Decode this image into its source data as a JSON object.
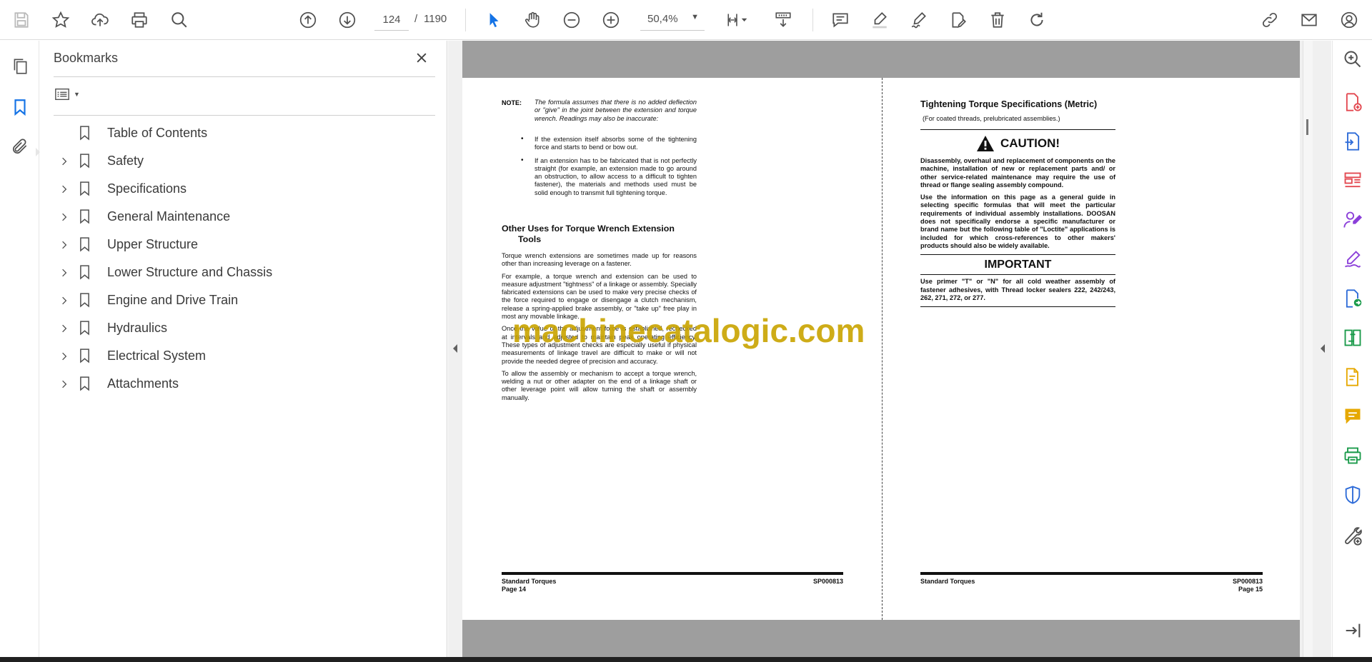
{
  "toolbar": {
    "current_page": "124",
    "page_separator": "/",
    "total_pages": "1190",
    "zoom": "50,4%",
    "icons": [
      "save-icon",
      "bookmark-star-icon",
      "upload-icon",
      "print-icon",
      "zoom-find-icon",
      "prev-page-icon",
      "next-page-icon",
      "select-cursor-icon",
      "hand-icon",
      "zoom-out-icon",
      "zoom-in-icon",
      "page-fit-icon",
      "scroll-mode-icon",
      "comment-icon",
      "highlight-icon",
      "sign-icon",
      "fill-sign-icon",
      "delete-icon",
      "rotate-icon",
      "share-link-icon",
      "email-icon",
      "account-icon"
    ]
  },
  "bookmarks": {
    "title": "Bookmarks",
    "items": [
      {
        "label": "Table of Contents",
        "expandable": false
      },
      {
        "label": "Safety",
        "expandable": true
      },
      {
        "label": "Specifications",
        "expandable": true
      },
      {
        "label": "General Maintenance",
        "expandable": true
      },
      {
        "label": "Upper Structure",
        "expandable": true
      },
      {
        "label": "Lower Structure and Chassis",
        "expandable": true
      },
      {
        "label": "Engine and Drive Train",
        "expandable": true
      },
      {
        "label": "Hydraulics",
        "expandable": true
      },
      {
        "label": "Electrical System",
        "expandable": true
      },
      {
        "label": "Attachments",
        "expandable": true
      }
    ]
  },
  "document": {
    "left_page": {
      "note_label": "NOTE:",
      "note_text": "The formula assumes that there is no added deflection or \"give\" in the joint between the extension and torque wrench. Readings may also be inaccurate:",
      "bullets": [
        "If the extension itself absorbs some of the tightening force and starts to bend or bow out.",
        "If an extension has to be fabricated that is not perfectly straight (for example, an extension made to go around an obstruction, to allow access to a difficult to tighten fastener), the materials and methods used must be solid enough to transmit full tightening torque."
      ],
      "heading_line1": "Other Uses for Torque Wrench Extension",
      "heading_line2": "Tools",
      "paragraphs": [
        "Torque wrench extensions are sometimes made up for reasons other than increasing leverage on a fastener.",
        "For example, a torque wrench and extension can be used to measure adjustment \"tightness\" of a linkage or assembly. Specially fabricated extensions can be used to make very precise checks of the force required to engage or disengage a clutch mechanism, release a spring-applied brake assembly, or \"take up\" free play in most any movable linkage.",
        "Once the value of the adjustment force is established, rechecked at intervals and adjusted to maintain peak operating efficiency. These types of adjustment checks are especially useful if physical measurements of linkage travel are difficult to make or will not provide the needed degree of precision and accuracy.",
        "To allow the assembly or mechanism to accept a torque wrench, welding a nut or other adapter on the end of a linkage shaft or other leverage point will allow turning the shaft or assembly manually."
      ],
      "footer_title": "Standard Torques",
      "footer_page": "Page 14",
      "footer_code": "SP000813"
    },
    "right_page": {
      "heading": "Tightening Torque Specifications (Metric)",
      "subheading": "(For coated threads, prelubricated assemblies.)",
      "caution_title": "CAUTION!",
      "caution_p1": "Disassembly, overhaul and replacement of components on the machine, installation of new or replacement parts and/ or other service-related maintenance may require the use of thread or flange sealing assembly compound.",
      "caution_p2": "Use the information on this page as a general guide in selecting specific formulas that will meet the particular requirements of individual assembly installations. DOOSAN does not specifically endorse a specific manufacturer or brand name but the following table of \"Loctite\" applications is included for which cross-references to other makers' products should also be widely available.",
      "important_title": "IMPORTANT",
      "important_text": "Use primer \"T\" or \"N\" for all cold weather assembly of fastener adhesives, with Thread locker sealers 222, 242/243, 262, 271, 272, or 277.",
      "footer_title": "Standard Torques",
      "footer_page": "Page 15",
      "footer_code": "SP000813"
    },
    "watermark": "machinecatalogic.com"
  },
  "colors": {
    "accent_blue": "#1473e6",
    "icon_gray": "#505050",
    "watermark": "#c9a400",
    "tool_red": "#e34850",
    "tool_blue": "#2d6bd8",
    "tool_purple": "#8b3fd9",
    "tool_green": "#1a9a4a",
    "tool_yellow": "#e6a800"
  }
}
